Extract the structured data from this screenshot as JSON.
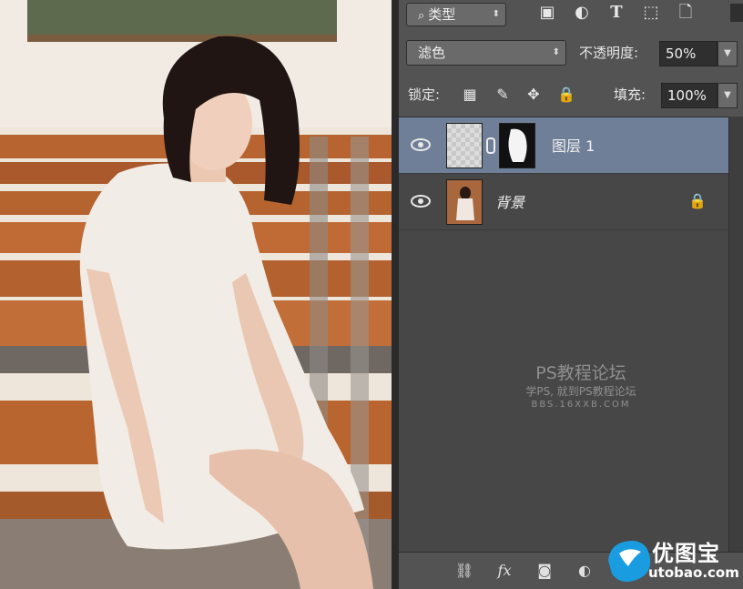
{
  "filter_row": {
    "kind_label": "类型",
    "icons": [
      "image-filter-icon",
      "adjustment-filter-icon",
      "type-filter-icon",
      "shape-filter-icon",
      "smart-object-filter-icon"
    ]
  },
  "blend_row": {
    "blend_mode": "滤色",
    "opacity_label": "不透明度:",
    "opacity_value": "50%"
  },
  "lock_row": {
    "lock_label": "锁定:",
    "fill_label": "填充:",
    "fill_value": "100%"
  },
  "layers": [
    {
      "name": "图层 1",
      "selected": true,
      "has_mask": true
    },
    {
      "name": "背景",
      "selected": false,
      "locked": true
    }
  ],
  "bottom_icons": [
    "link-layers-icon",
    "fx-icon",
    "add-mask-icon",
    "adjustment-layer-icon",
    "folder-icon"
  ],
  "bottom_fx": "fx",
  "watermark": {
    "line1": "PS教程论坛",
    "line2": "学PS, 就到PS教程论坛",
    "line3": "BBS.16XXB.COM"
  },
  "logo": {
    "name": "优图宝",
    "url": "utobao.com"
  },
  "colors": {
    "panel": "#535353",
    "selected_layer": "#6f7f97",
    "layers_bg": "#474747"
  }
}
